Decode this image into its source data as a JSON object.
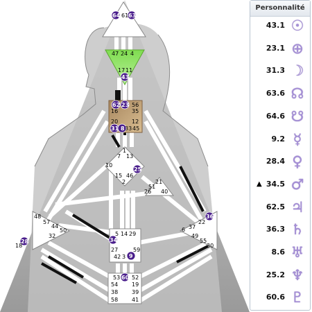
{
  "panel": {
    "title": "Personnalité",
    "rows": [
      {
        "marker": "",
        "value": "43.1",
        "icon": "sun-icon",
        "glyph": "☉"
      },
      {
        "marker": "",
        "value": "23.1",
        "icon": "earth-icon",
        "glyph": "⊕"
      },
      {
        "marker": "",
        "value": "31.3",
        "icon": "moon-icon",
        "glyph": "☽"
      },
      {
        "marker": "",
        "value": "63.6",
        "icon": "north-node-icon",
        "glyph": "☊"
      },
      {
        "marker": "",
        "value": "64.6",
        "icon": "south-node-icon",
        "glyph": "☋"
      },
      {
        "marker": "",
        "value": "9.2",
        "icon": "mercury-icon",
        "glyph": "☿"
      },
      {
        "marker": "",
        "value": "28.4",
        "icon": "venus-icon",
        "glyph": "♀"
      },
      {
        "marker": "▲",
        "value": "34.5",
        "icon": "mars-icon",
        "glyph": "♂"
      },
      {
        "marker": "",
        "value": "62.5",
        "icon": "jupiter-icon",
        "glyph": "♃"
      },
      {
        "marker": "",
        "value": "36.3",
        "icon": "saturn-icon",
        "glyph": "♄"
      },
      {
        "marker": "",
        "value": "8.6",
        "icon": "uranus-icon",
        "glyph": "♅"
      },
      {
        "marker": "",
        "value": "25.2",
        "icon": "neptune-icon",
        "glyph": "♆"
      },
      {
        "marker": "",
        "value": "60.6",
        "icon": "pluto-icon",
        "glyph": "♇"
      }
    ]
  },
  "gates": {
    "g64": "64",
    "g61": "61",
    "g63": "63",
    "g47": "47",
    "g24": "24",
    "g4": "4",
    "g17": "17",
    "g11": "11",
    "g43": "43",
    "g62": "62",
    "g23": "23",
    "g56": "56",
    "g16": "16",
    "g35": "35",
    "g20": "20",
    "g12": "12",
    "g31": "31",
    "g8": "8",
    "g33": "33",
    "g45": "45",
    "g1": "1",
    "g7": "7",
    "g13": "13",
    "g10": "10",
    "g25": "25",
    "g15": "15",
    "g46": "46",
    "g2": "2",
    "g21": "21",
    "g51": "51",
    "g26": "26",
    "g40": "40",
    "g48": "48",
    "g57": "57",
    "g44": "44",
    "g50": "50",
    "g32": "32",
    "g28": "28",
    "g18": "18",
    "g5": "5",
    "g14": "14",
    "g29": "29",
    "g34": "34",
    "g27": "27",
    "g59": "59",
    "g42": "42",
    "g3": "3",
    "g9": "9",
    "g36": "36",
    "g22": "22",
    "g6": "6",
    "g37": "37",
    "g49": "49",
    "g55": "55",
    "g30": "30",
    "g53": "53",
    "g60": "60",
    "g52": "52",
    "g54": "54",
    "g19": "19",
    "g38": "38",
    "g39": "39",
    "g58": "58",
    "g41": "41"
  },
  "colors": {
    "background_gray": "#a6a6a6",
    "head_center": "#ffffff",
    "ajna_center": "#8fe06a",
    "g_center": "#b99a70",
    "activated_gate": "#4a1e8c",
    "channel_black": "#111111",
    "glyph_color": "#a58fd6"
  }
}
